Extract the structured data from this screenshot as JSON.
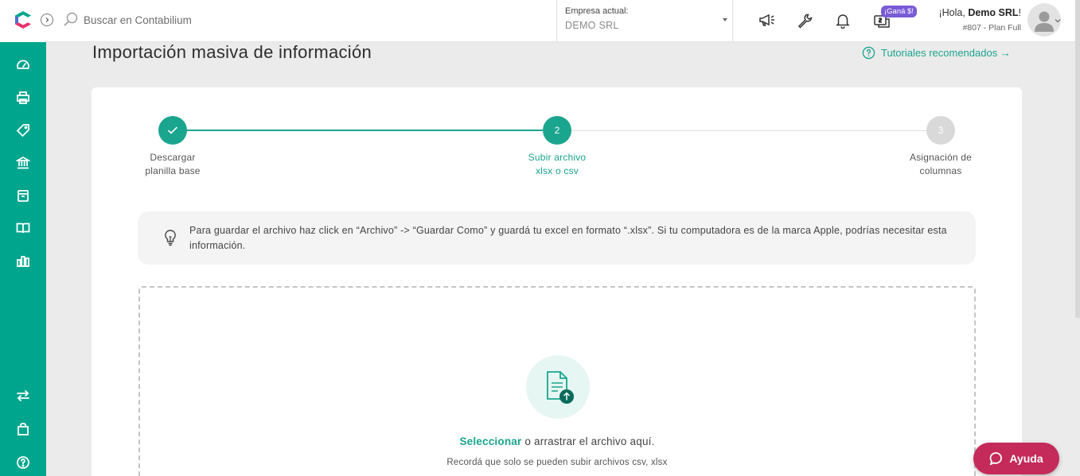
{
  "colors": {
    "brand": "#00a58d",
    "accent_text": "#1aa58e",
    "help": "#c42a5a",
    "badge": "#7a5bd6",
    "step_inactive": "#d9d9d9"
  },
  "search": {
    "placeholder": "Buscar en Contabilium"
  },
  "company": {
    "label": "Empresa actual:",
    "value": "DEMO SRL"
  },
  "topbar": {
    "icons": [
      "megaphone-icon",
      "wrench-icon",
      "bell-icon",
      "gift-icon"
    ],
    "badge": "¡Ganá $!",
    "greeting_prefix": "¡Hola, ",
    "user_name": "Demo SRL",
    "greeting_suffix": "!",
    "plan": "#807 - Plan Full"
  },
  "sidebar": {
    "items": [
      "dashboard-icon",
      "printer-icon",
      "tag-icon",
      "bank-icon",
      "box-icon",
      "book-icon",
      "bar-chart-icon"
    ],
    "bottom_items": [
      "transfer-icon",
      "shopping-bag-icon",
      "help-circle-icon"
    ]
  },
  "page": {
    "title": "Importación masiva de información",
    "tutorials_link": "Tutoriales recomendados →"
  },
  "stepper": {
    "current_step": 2,
    "steps": [
      {
        "number": "",
        "line1": "Descargar",
        "line2": "planilla base",
        "state": "done"
      },
      {
        "number": "2",
        "line1": "Subir archivo",
        "line2": "xlsx o csv",
        "state": "active"
      },
      {
        "number": "3",
        "line1": "Asignación de",
        "line2": "columnas",
        "state": "pending"
      }
    ]
  },
  "tip": {
    "text": "Para guardar el archivo haz click en “Archivo” -> “Guardar Como” y guardá tu excel en formato “.xlsx”. Si tu computadora es de la marca Apple, podrías necesitar esta información."
  },
  "dropzone": {
    "select_label": "Seleccionar",
    "rest_label": "o arrastrar el archivo aquí.",
    "note": "Recordá que solo se pueden subir archivos csv, xlsx"
  },
  "help_button": {
    "label": "Ayuda"
  }
}
